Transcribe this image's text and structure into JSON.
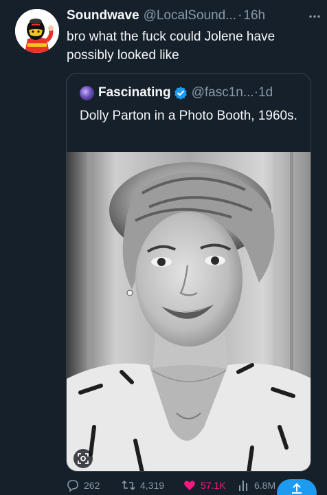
{
  "tweet": {
    "author_name": "Soundwave",
    "author_handle": "@LocalSound...",
    "separator": "·",
    "timestamp": "16h",
    "text": "bro what the fuck could Jolene have possibly looked like"
  },
  "quote": {
    "author_name": "Fascinating",
    "author_handle": "@fasc1n...",
    "separator": "·",
    "timestamp": "1d",
    "text": "Dolly Parton in a Photo Booth, 1960s."
  },
  "actions": {
    "replies": "262",
    "reposts": "4,319",
    "likes": "57.1K",
    "views": "6.8M"
  },
  "colors": {
    "background": "#15202b",
    "muted_text": "#8b98a5",
    "like_pink": "#f91880",
    "accent_blue": "#1d9bf0"
  },
  "icons": {
    "more": "more-dots-icon",
    "verified": "verified-badge-icon",
    "reply": "reply-bubble-icon",
    "repost": "repost-arrows-icon",
    "like": "heart-filled-icon",
    "views": "views-bar-icon",
    "share": "share-up-arrow-icon",
    "lens": "lens-search-icon"
  }
}
